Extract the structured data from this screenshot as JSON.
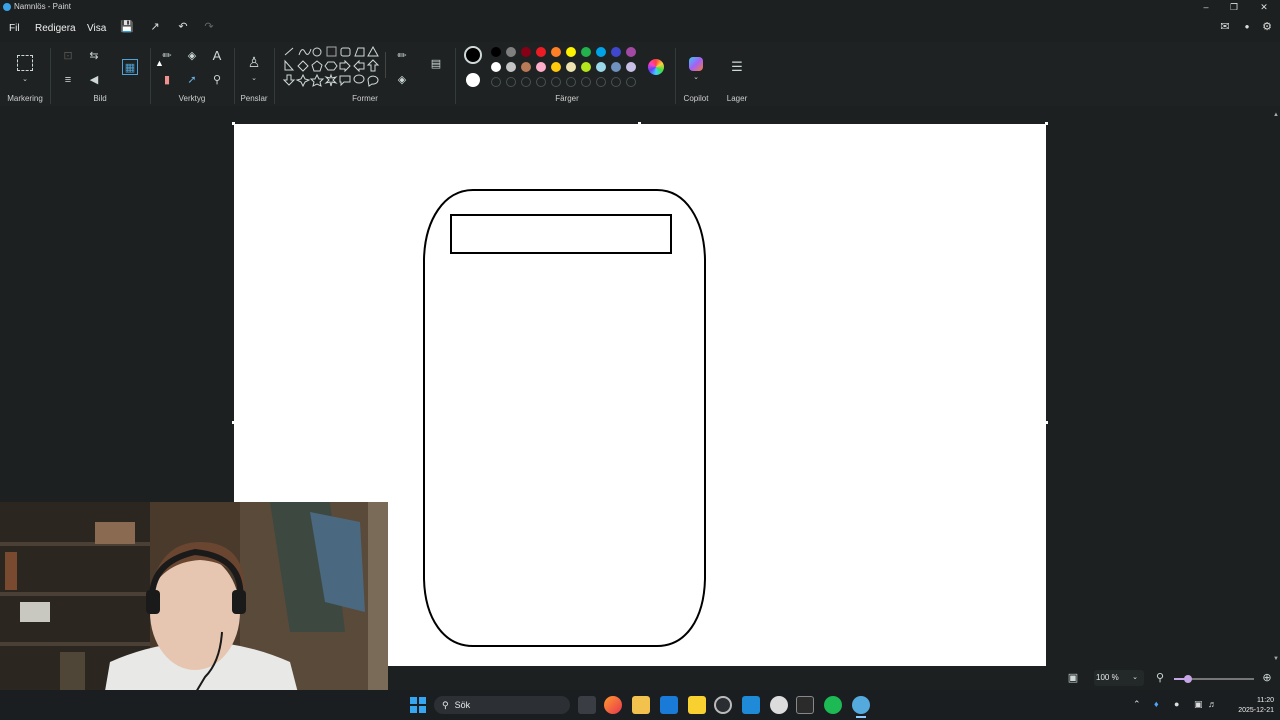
{
  "window": {
    "title": "Namnlös - Paint",
    "min_icon": "minimize-icon",
    "restore_icon": "restore-icon",
    "close_icon": "close-icon"
  },
  "menu": {
    "items": [
      "Fil",
      "Redigera",
      "Visa"
    ]
  },
  "ribbon": {
    "groups": {
      "markering": "Markering",
      "bild": "Bild",
      "verktyg": "Verktyg",
      "penslar": "Penslar",
      "former": "Former",
      "farger": "Färger",
      "copilot": "Copilot",
      "lager": "Lager"
    },
    "colors_row1": [
      "#000000",
      "#7f7f7f",
      "#880015",
      "#ed1c24",
      "#ff7f27",
      "#fff200",
      "#22b14c",
      "#00a2e8",
      "#3f48cc",
      "#a349a4"
    ],
    "colors_row2": [
      "#ffffff",
      "#c3c3c3",
      "#b97a57",
      "#ffaec9",
      "#ffc90e",
      "#efe4b0",
      "#b5e61d",
      "#99d9ea",
      "#7092be",
      "#c8bfe7"
    ],
    "primary_color": "#000000",
    "secondary_color": "#ffffff"
  },
  "status": {
    "zoom": "100 %"
  },
  "taskbar": {
    "search_placeholder": "Sök",
    "time": "11:20",
    "date": "2025-12-21"
  }
}
